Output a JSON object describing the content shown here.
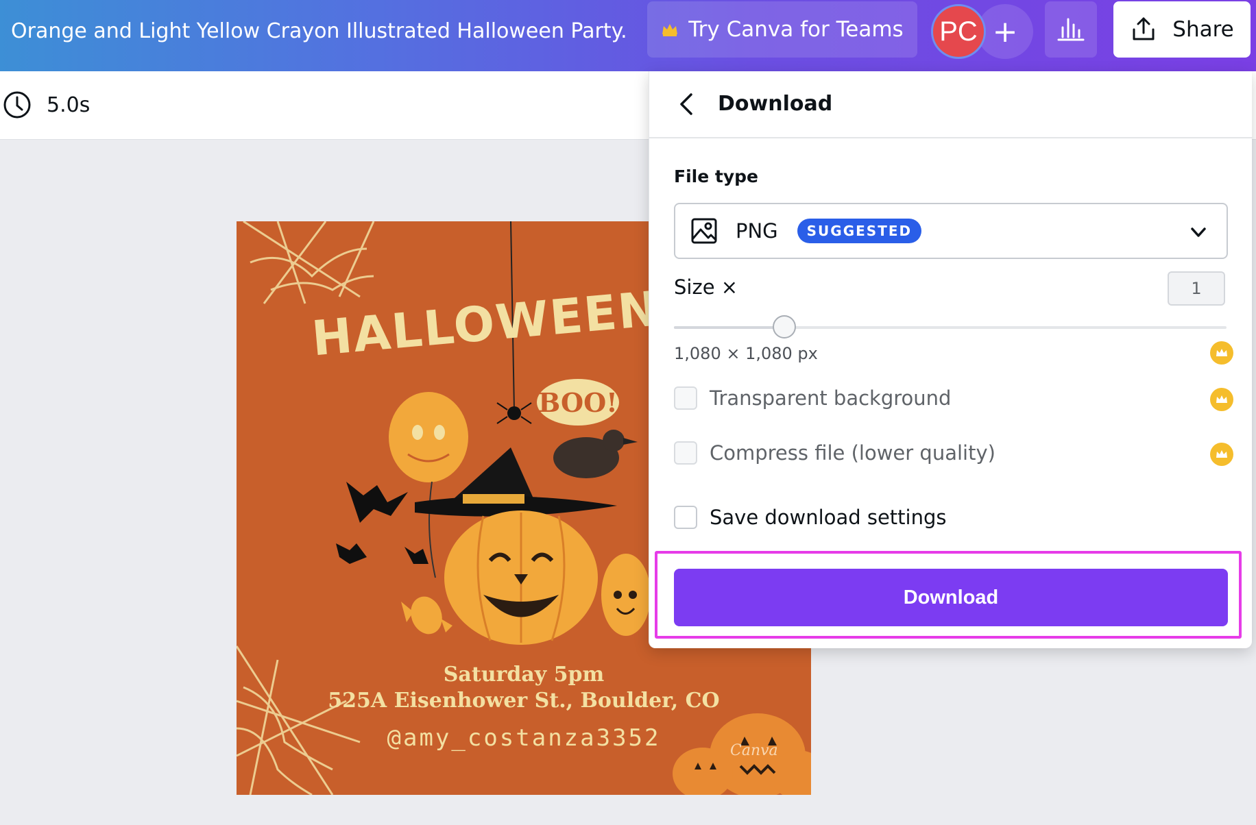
{
  "header": {
    "doc_title": "Orange and Light Yellow Crayon Illustrated Halloween Party...",
    "teams_label": "Try Canva for Teams",
    "teams_icon": "crown-icon",
    "avatar_initials": "PC",
    "add_member_icon": "plus-icon",
    "insights_icon": "bar-chart-icon",
    "share_label": "Share",
    "share_icon": "upload-icon"
  },
  "toolbar": {
    "duration": "5.0s",
    "duration_icon": "clock-icon"
  },
  "design": {
    "headline": "HALLOWEEN PAR",
    "bubble_text": "BOO!",
    "line1": "Saturday 5pm",
    "line2": "525A Eisenhower St., Boulder, CO",
    "line3": "@amy_costanza3352",
    "watermark": "Canva",
    "colors": {
      "background": "#c85f2b",
      "text": "#f3e0a2"
    }
  },
  "download_panel": {
    "title": "Download",
    "back_icon": "chevron-left-icon",
    "file_type_label": "File type",
    "file_type_value": "PNG",
    "file_type_badge": "SUGGESTED",
    "file_type_icon": "image-icon",
    "size_label": "Size ×",
    "size_value": "1",
    "size_slider_fraction": 0.2,
    "dimensions": "1,080 × 1,080 px",
    "options": [
      {
        "label": "Transparent background",
        "checked": false,
        "premium": true
      },
      {
        "label": "Compress file (lower quality)",
        "checked": false,
        "premium": true
      },
      {
        "label": "Save download settings",
        "checked": false,
        "premium": false
      }
    ],
    "download_button": "Download",
    "colors": {
      "primary": "#7c3cf2",
      "badge": "#2a5ee8",
      "premium": "#f5bd2c",
      "highlight": "#e63ce8"
    }
  }
}
